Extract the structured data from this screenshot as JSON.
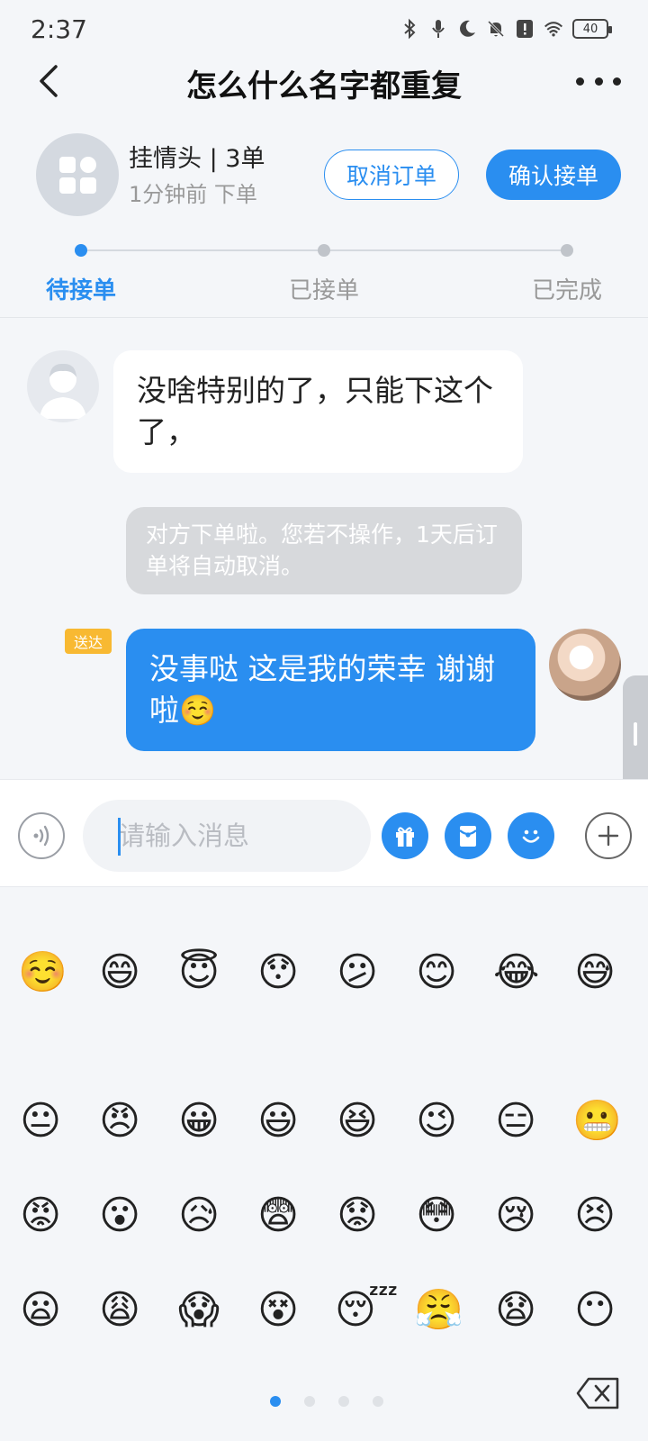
{
  "status": {
    "time": "2:37",
    "battery": "40"
  },
  "nav": {
    "title": "怎么什么名字都重复"
  },
  "order": {
    "name": "挂情头 | 3单",
    "time": "1分钟前 下单",
    "cancel_label": "取消订单",
    "confirm_label": "确认接单"
  },
  "progress": {
    "steps": [
      "待接单",
      "已接单",
      "已完成"
    ],
    "active_index": 0
  },
  "chat": {
    "incoming_text": "没啥特别的了，只能下这个了，",
    "system_text": "对方下单啦。您若不操作，1天后订单将自动取消。",
    "delivered_label": "送达",
    "outgoing_text": "没事哒 这是我的荣幸 谢谢啦☺️"
  },
  "input": {
    "placeholder": "请输入消息"
  },
  "emoji_panel": {
    "rows": [
      [
        "☺️",
        "😄",
        "😇",
        "😯",
        "😕",
        "😊",
        "😂",
        "😅"
      ],
      [
        "😐",
        "😠",
        "😀",
        "😃",
        "😆",
        "😉",
        "😑",
        "😬"
      ],
      [
        "😡",
        "😮",
        "😥",
        "😨",
        "😟",
        "😳",
        "😢",
        "😣"
      ],
      [
        "😦",
        "😩",
        "😱",
        "😵",
        "😴",
        "😤",
        "😧",
        "😶"
      ]
    ],
    "page_count": 4,
    "active_page": 0
  },
  "colors": {
    "accent": "#2a8ef0",
    "badge": "#f8b932",
    "background": "#f4f6f9"
  }
}
